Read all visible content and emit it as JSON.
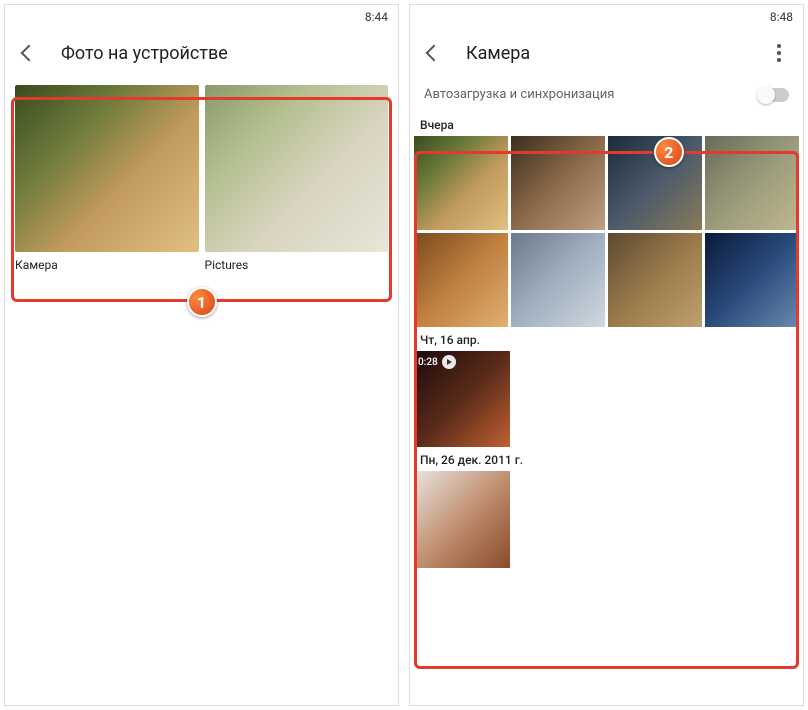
{
  "left": {
    "time": "8:44",
    "title": "Фото на устройстве",
    "folders": [
      {
        "label": "Камера"
      },
      {
        "label": "Pictures"
      }
    ],
    "badge": "1"
  },
  "right": {
    "time": "8:48",
    "title": "Камера",
    "sync_label": "Автозагрузка и синхронизация",
    "badge": "2",
    "sections": [
      {
        "label": "Вчера"
      },
      {
        "label": "Чт, 16 апр."
      },
      {
        "label": "Пн, 26 дек. 2011 г."
      }
    ],
    "video_duration": "0:28"
  }
}
